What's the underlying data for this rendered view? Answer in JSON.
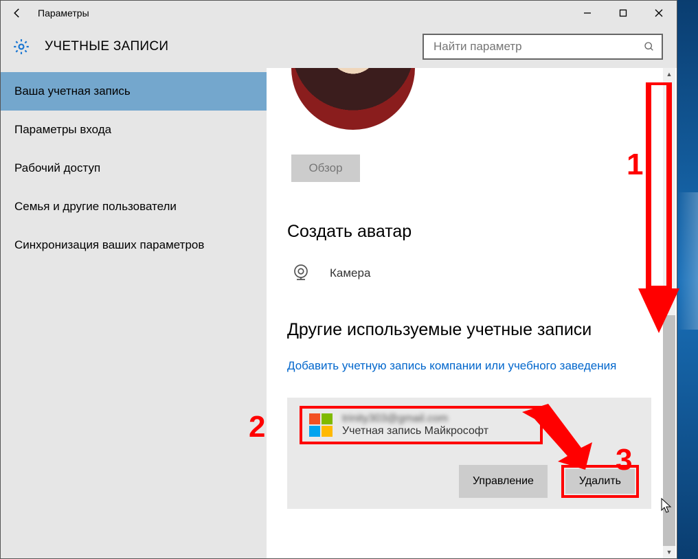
{
  "titlebar": {
    "title": "Параметры"
  },
  "header": {
    "title": "УЧЕТНЫЕ ЗАПИСИ",
    "search_placeholder": "Найти параметр"
  },
  "sidebar": {
    "items": [
      {
        "label": "Ваша учетная запись",
        "active": true
      },
      {
        "label": "Параметры входа"
      },
      {
        "label": "Рабочий доступ"
      },
      {
        "label": "Семья и другие пользователи"
      },
      {
        "label": "Синхронизация ваших параметров"
      }
    ]
  },
  "content": {
    "browse_label": "Обзор",
    "create_avatar_heading": "Создать аватар",
    "camera_label": "Камера",
    "other_accounts_heading": "Другие используемые учетные записи",
    "add_account_link": "Добавить учетную запись компании или учебного заведения",
    "account": {
      "email": "trinity303@gmail.com",
      "type": "Учетная запись Майкрософт"
    },
    "manage_label": "Управление",
    "delete_label": "Удалить"
  },
  "annotations": {
    "n1": "1",
    "n2": "2",
    "n3": "3"
  }
}
